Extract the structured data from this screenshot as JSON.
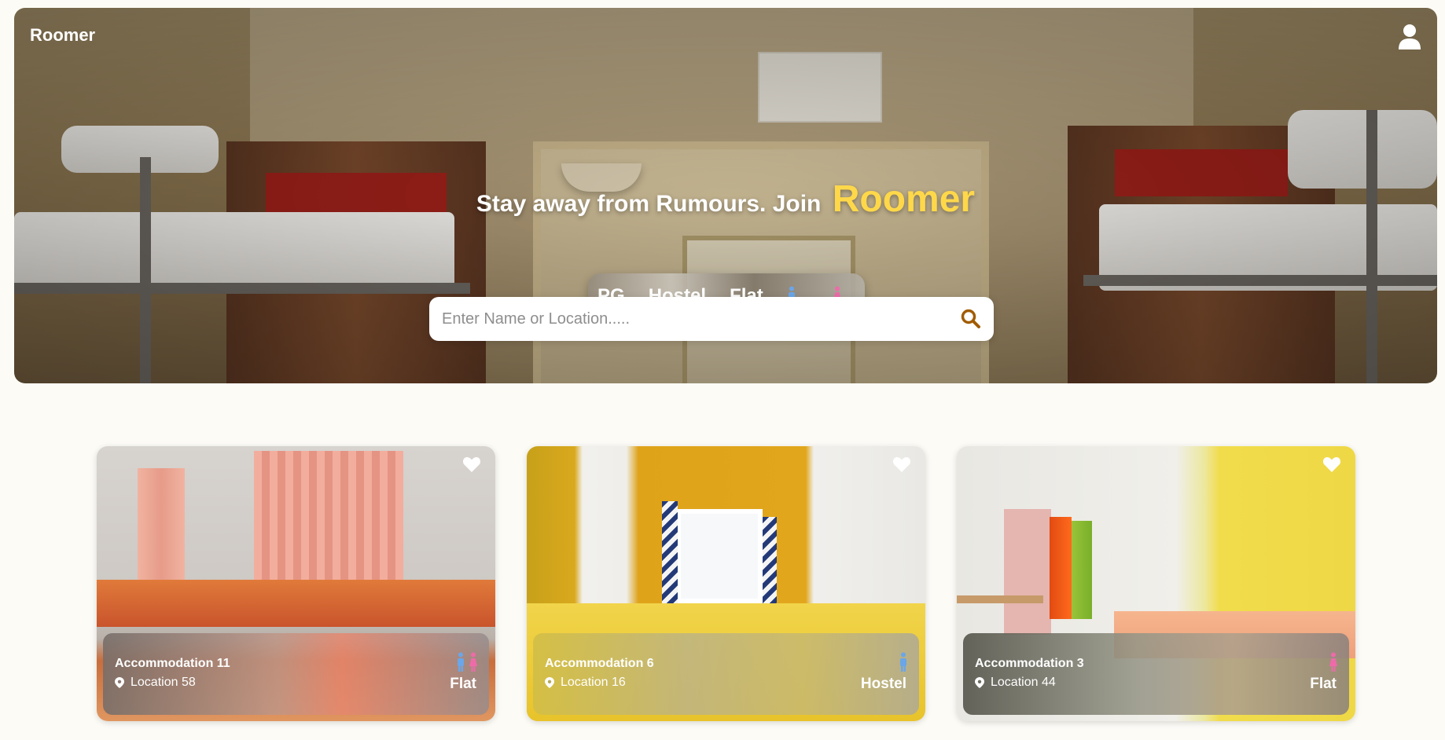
{
  "header": {
    "brand": "Roomer",
    "profile_icon": "user-icon"
  },
  "hero": {
    "tagline": "Stay away from Rumours. Join",
    "tagline_accent": "Roomer",
    "accent_color": "#ffd84a",
    "types": [
      "PG",
      "Hostel",
      "Flat"
    ],
    "gender_icons": [
      "male-icon",
      "female-icon"
    ],
    "search": {
      "placeholder": "Enter Name or Location.....",
      "value": "",
      "icon": "search-icon"
    }
  },
  "colors": {
    "male": "#6aa6e8",
    "female": "#ee6ba9",
    "search_icon": "#a15c00",
    "background": "#fcfbf6"
  },
  "listings": [
    {
      "name": "Accommodation 11",
      "location": "Location 58",
      "type": "Flat",
      "genders": [
        "male",
        "female"
      ],
      "favorite_icon": "heart-icon"
    },
    {
      "name": "Accommodation 6",
      "location": "Location 16",
      "type": "Hostel",
      "genders": [
        "male"
      ],
      "favorite_icon": "heart-icon"
    },
    {
      "name": "Accommodation 3",
      "location": "Location 44",
      "type": "Flat",
      "genders": [
        "female"
      ],
      "favorite_icon": "heart-icon"
    }
  ]
}
